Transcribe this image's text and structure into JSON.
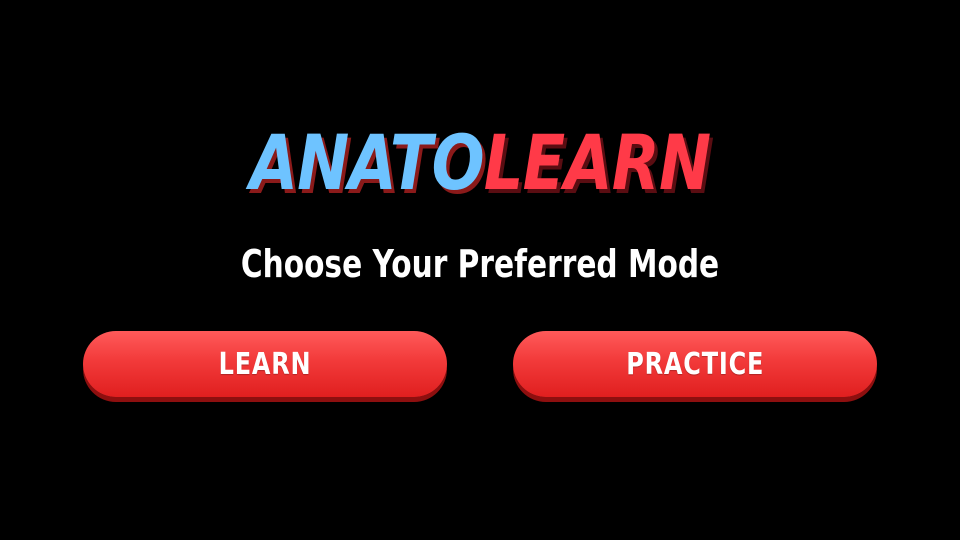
{
  "logo": {
    "part1": "ANATO",
    "part2": "LEARN"
  },
  "subtitle": "Choose Your Preferred Mode",
  "buttons": {
    "learn_label": "LEARN",
    "practice_label": "PRACTICE"
  },
  "colors": {
    "background": "#000000",
    "logo_blue": "#6ec3ff",
    "logo_red": "#ff3a48",
    "button_red": "#f23a3a",
    "text_white": "#ffffff"
  }
}
